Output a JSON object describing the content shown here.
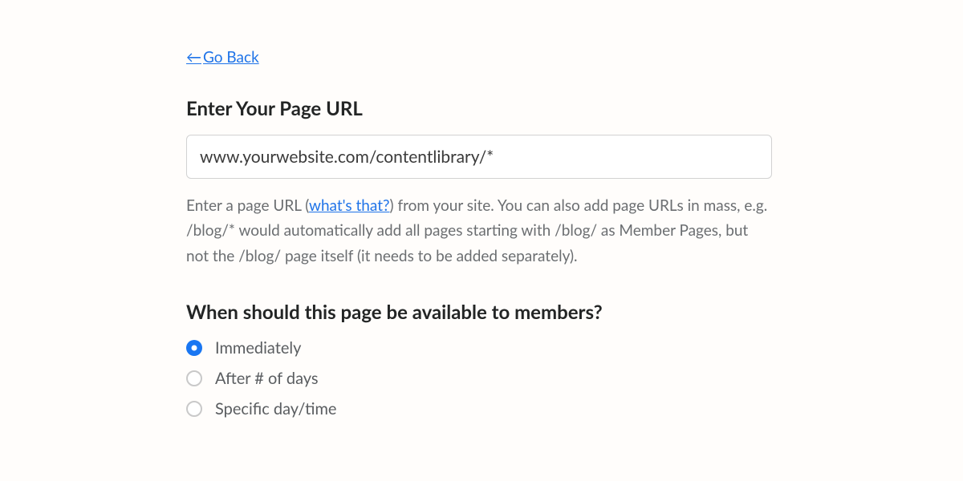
{
  "nav": {
    "go_back_label": "Go Back",
    "go_back_arrow": "←"
  },
  "url_section": {
    "heading": "Enter Your Page URL",
    "input_value": "www.yourwebsite.com/contentlibrary/*",
    "help_prefix": "Enter a page URL (",
    "help_link": "what's that?",
    "help_suffix": ") from your site. You can also add page URLs in mass, e.g. /blog/* would automatically add all pages starting with /blog/ as Member Pages, but not the /blog/ page itself (it needs to be added separately)."
  },
  "availability_section": {
    "heading": "When should this page be available to members?",
    "options": {
      "immediately": "Immediately",
      "after_days": "After # of days",
      "specific": "Specific day/time"
    },
    "selected": "immediately"
  }
}
